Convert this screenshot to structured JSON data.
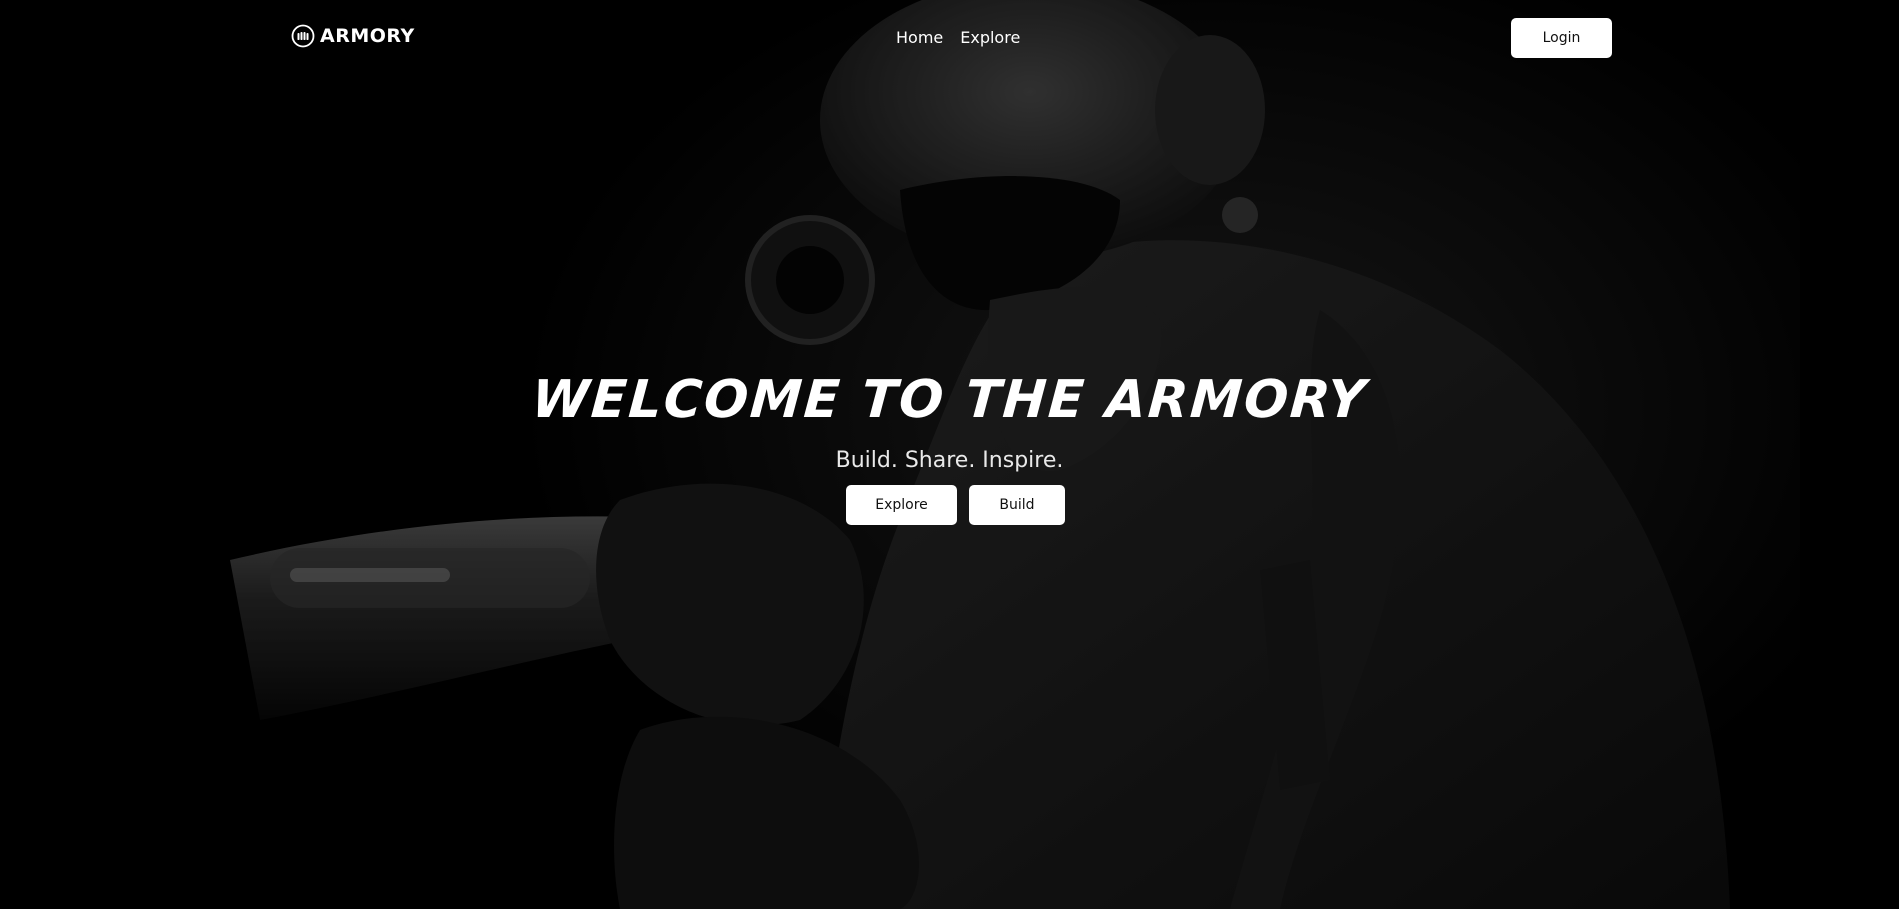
{
  "navbar": {
    "logo_icon": "bullets-icon",
    "logo_text": "ARMORY",
    "links": [
      "Home",
      "Explore"
    ],
    "login_label": "Login"
  },
  "hero": {
    "title": "WELCOME TO THE ARMORY",
    "subtitle": "Build. Share. Inspire.",
    "buttons": [
      "Explore",
      "Build"
    ],
    "background_image": "soldier-illustration"
  },
  "colors": {
    "background": "#000000",
    "text": "#ffffff",
    "button_bg": "#ffffff",
    "button_text": "#111111"
  }
}
